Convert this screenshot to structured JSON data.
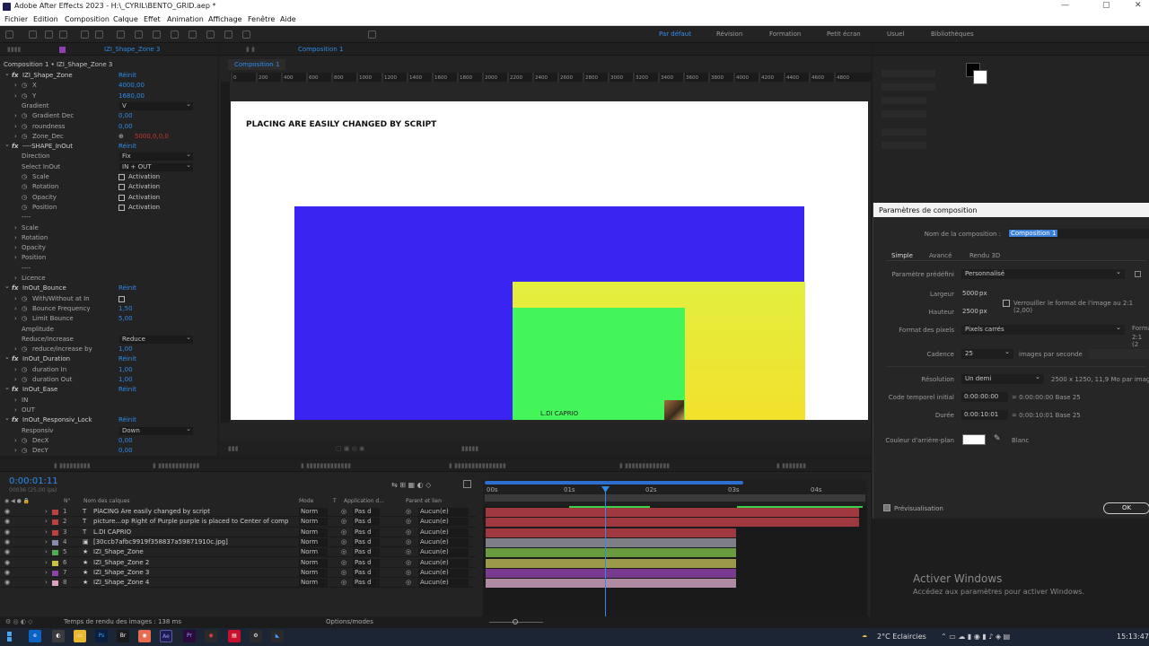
{
  "window": {
    "title": "Adobe After Effects 2023 - H:\\_CYRIL\\BENTO_GRID.aep *",
    "min": "—",
    "max": "▢",
    "close": "✕"
  },
  "menu": [
    "Fichier",
    "Edition",
    "Composition",
    "Calque",
    "Effet",
    "Animation",
    "Affichage",
    "Fenêtre",
    "Aide"
  ],
  "workspaces": [
    {
      "label": "Par défaut",
      "active": true
    },
    {
      "label": "Révision"
    },
    {
      "label": "Formation"
    },
    {
      "label": "Petit écran"
    },
    {
      "label": "Usuel"
    },
    {
      "label": "Bibliothèques"
    }
  ],
  "effect_controls": {
    "tab_label": "IZI_Shape_Zone 3",
    "header": "Composition 1 • IZI_Shape_Zone 3",
    "rows": [
      {
        "kind": "fx",
        "label": "IZI_Shape_Zone",
        "value": "Réinit"
      },
      {
        "kind": "prop",
        "label": "X",
        "value": "4000,00"
      },
      {
        "kind": "prop",
        "label": "Y",
        "value": "1680,00"
      },
      {
        "kind": "dd",
        "label": "Gradient",
        "value": "V"
      },
      {
        "kind": "prop",
        "label": "Gradient Dec",
        "value": "0,00"
      },
      {
        "kind": "prop",
        "label": "roundness",
        "value": "0,00"
      },
      {
        "kind": "point",
        "label": "Zone_Dec",
        "value": "5000,0,0,0"
      },
      {
        "kind": "fx",
        "label": "----SHAPE_InOut",
        "value": "Réinit"
      },
      {
        "kind": "dd",
        "label": "Direction",
        "value": "Fix"
      },
      {
        "kind": "dd",
        "label": "Select InOut",
        "value": "IN + OUT"
      },
      {
        "kind": "cb",
        "label": "Scale",
        "value": "Activation"
      },
      {
        "kind": "cb",
        "label": "Rotation",
        "value": "Activation"
      },
      {
        "kind": "cb",
        "label": "Opacity",
        "value": "Activation"
      },
      {
        "kind": "cb",
        "label": "Position",
        "value": "Activation"
      },
      {
        "kind": "sep",
        "label": "----",
        "value": ""
      },
      {
        "kind": "group",
        "label": "Scale",
        "value": ""
      },
      {
        "kind": "group",
        "label": "Rotation",
        "value": ""
      },
      {
        "kind": "group",
        "label": "Opacity",
        "value": ""
      },
      {
        "kind": "group",
        "label": "Position",
        "value": ""
      },
      {
        "kind": "sep",
        "label": "----",
        "value": ""
      },
      {
        "kind": "group",
        "label": "Licence",
        "value": ""
      },
      {
        "kind": "fx",
        "label": "InOut_Bounce",
        "value": "Réinit"
      },
      {
        "kind": "cbonly",
        "label": "With/Without at In",
        "value": ""
      },
      {
        "kind": "prop",
        "label": "Bounce Frequency",
        "value": "1,50"
      },
      {
        "kind": "prop",
        "label": "Limit Bounce",
        "value": "5,00"
      },
      {
        "kind": "plain",
        "label": "Amplitude",
        "value": ""
      },
      {
        "kind": "dd",
        "label": "Reduce/Increase",
        "value": "Reduce"
      },
      {
        "kind": "prop",
        "label": "reduce/increase by",
        "value": "1,00"
      },
      {
        "kind": "fx",
        "label": "InOut_Duration",
        "value": "Réinit"
      },
      {
        "kind": "prop",
        "label": "duration In",
        "value": "1,00"
      },
      {
        "kind": "prop",
        "label": "duration Out",
        "value": "1,00"
      },
      {
        "kind": "fx",
        "label": "InOut_Ease",
        "value": "Réinit"
      },
      {
        "kind": "group",
        "label": "IN",
        "value": ""
      },
      {
        "kind": "group",
        "label": "OUT",
        "value": ""
      },
      {
        "kind": "fx",
        "label": "InOut_Responsiv_Lock",
        "value": "Réinit"
      },
      {
        "kind": "dd",
        "label": "Responsiv",
        "value": "Down"
      },
      {
        "kind": "prop",
        "label": "DecX",
        "value": "0,00"
      },
      {
        "kind": "prop",
        "label": "DecY",
        "value": "0,00"
      }
    ]
  },
  "comp": {
    "tab_label": "Composition 1",
    "breadcrumb": "Composition 1",
    "ruler_ticks": [
      "0",
      "200",
      "400",
      "600",
      "800",
      "1000",
      "1200",
      "1400",
      "1600",
      "1800",
      "2000",
      "2200",
      "2400",
      "2600",
      "2800",
      "3000",
      "3200",
      "3400",
      "3600",
      "3800",
      "4000",
      "4200",
      "4400",
      "4600",
      "4800"
    ],
    "heading": "PLACING ARE EASILY CHANGED BY SCRIPT",
    "caption": "L.DI CAPRIO",
    "colors": {
      "blue": "#3a24f2",
      "yellow": "#e8e840",
      "green": "#44f55a"
    }
  },
  "timeline": {
    "timecode": "0:00:01:11",
    "fps": "00036 (25,00 ips)",
    "col_headers": {
      "num": "N°",
      "name": "Nom des calques",
      "mode": "Mode",
      "t": "T",
      "matte": "Application d...",
      "parent": "Parent et lien"
    },
    "time_marks": [
      "00s",
      "01s",
      "02s",
      "03s",
      "04s"
    ],
    "layers": [
      {
        "num": "1",
        "type": "T",
        "name": "PlACING Are easily changed by script",
        "mode": "Norm",
        "matte": "Pas d",
        "parent": "Aucun(e)",
        "color": "#c04040",
        "bar": "#a0393f"
      },
      {
        "num": "2",
        "type": "T",
        "name": "picture...op Right of Purple purple is placed to Center of comp",
        "mode": "Norm",
        "matte": "Pas d",
        "parent": "Aucun(e)",
        "color": "#c04040",
        "bar": "#a0393f"
      },
      {
        "num": "3",
        "type": "T",
        "name": "L.DI CAPRIO",
        "mode": "Norm",
        "matte": "Pas d",
        "parent": "Aucun(e)",
        "color": "#c04040",
        "bar": "#a0393f"
      },
      {
        "num": "4",
        "type": "▣",
        "name": "[30ccb7afbc9919f358837a59871910c.jpg]",
        "mode": "Norm",
        "matte": "Pas d",
        "parent": "Aucun(e)",
        "color": "#8a8ab0",
        "bar": "#7e7e86"
      },
      {
        "num": "5",
        "type": "★",
        "name": "IZI_Shape_Zone",
        "mode": "Norm",
        "matte": "Pas d",
        "parent": "Aucun(e)",
        "color": "#4caf50",
        "bar": "#6a9a3e"
      },
      {
        "num": "6",
        "type": "★",
        "name": "IZI_Shape_Zone 2",
        "mode": "Norm",
        "matte": "Pas d",
        "parent": "Aucun(e)",
        "color": "#c8c040",
        "bar": "#9a9a4a"
      },
      {
        "num": "7",
        "type": "★",
        "name": "IZI_Shape_Zone 3",
        "mode": "Norm",
        "matte": "Pas d",
        "parent": "Aucun(e)",
        "color": "#9040b0",
        "bar": "#7a3a8e"
      },
      {
        "num": "8",
        "type": "★",
        "name": "IZI_Shape_Zone 4",
        "mode": "Norm",
        "matte": "Pas d",
        "parent": "Aucun(e)",
        "color": "#e0a0c0",
        "bar": "#b08aa0"
      }
    ],
    "footer": "Temps de rendu des images : 138 ms",
    "options": "Options/modes"
  },
  "dialog": {
    "title": "Paramètres de composition",
    "name_label": "Nom de la composition :",
    "name_value": "Composition 1",
    "tabs": [
      "Simple",
      "Avancé",
      "Rendu 3D"
    ],
    "preset_label": "Paramètre prédéfini",
    "preset_value": "Personnalisé",
    "width_label": "Largeur",
    "width_value": "5000",
    "height_label": "Hauteur",
    "height_value": "2500",
    "px": "px",
    "lock_label": "Verrouiller le format de l'image au 2:1 (2,00)",
    "pixel_label": "Format des pixels",
    "pixel_value": "Pixels carrés",
    "frame_aspect": "Forma",
    "frame_aspect2": "2:1 (2",
    "rate_label": "Cadence",
    "rate_value": "25",
    "rate_unit": "images par seconde",
    "res_label": "Résolution",
    "res_value": "Un demi",
    "res_info": "2500 x 1250, 11,9 Mo par image 8",
    "start_label": "Code temporel initial",
    "start_value": "0:00:00:00",
    "start_info": "= 0:00:00:00  Base 25",
    "dur_label": "Durée",
    "dur_value": "0:00:10:01",
    "dur_info": "= 0:00:10:01  Base 25",
    "bg_label": "Couleur d'arrière-plan",
    "bg_value": "Blanc",
    "preview_label": "Prévisualisation",
    "ok": "OK"
  },
  "activate": {
    "title": "Activer Windows",
    "sub": "Accédez aux paramètres pour activer Windows."
  },
  "taskbar": {
    "weather": "2°C  Eclaircies",
    "time": "15:13:47"
  }
}
